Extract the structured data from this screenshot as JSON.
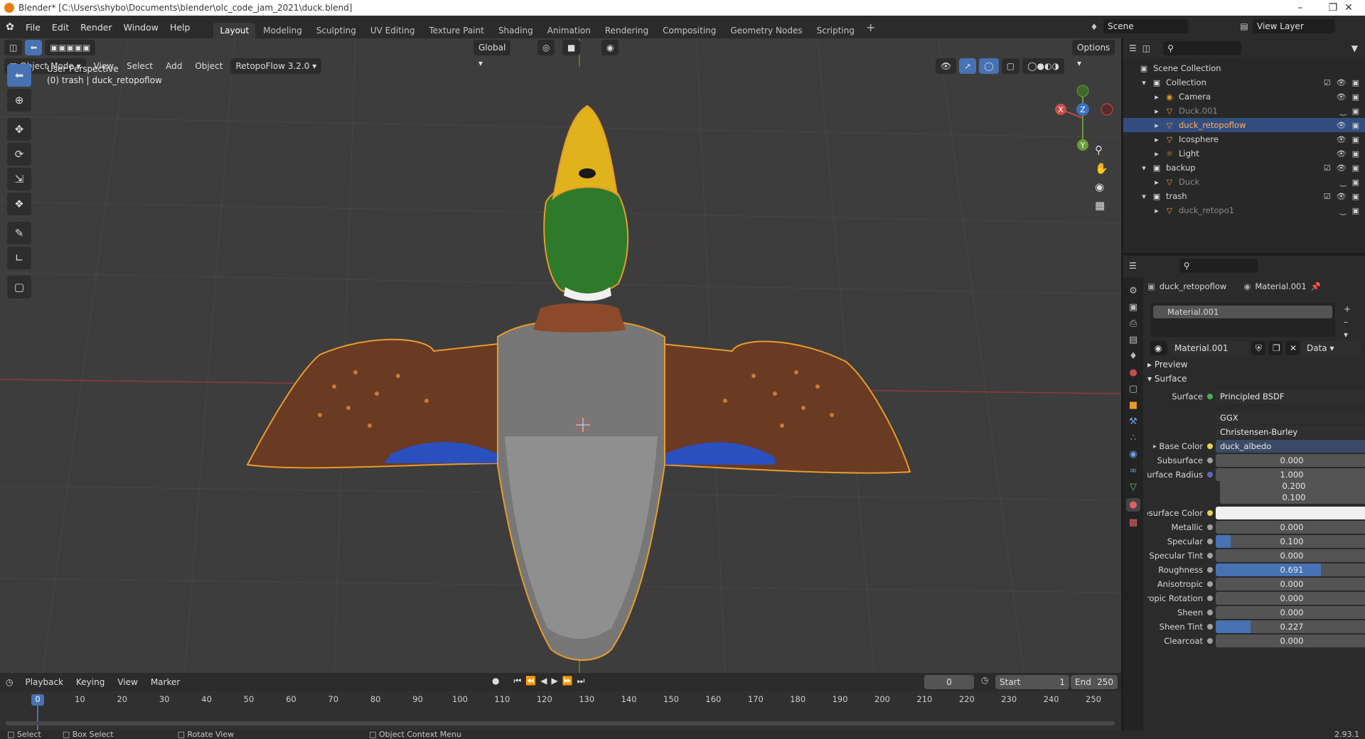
{
  "titlebar": {
    "title": "Blender* [C:\\Users\\shybo\\Documents\\blender\\olc_code_jam_2021\\duck.blend]"
  },
  "menu": [
    "File",
    "Edit",
    "Render",
    "Window",
    "Help"
  ],
  "workspaces": [
    "Layout",
    "Modeling",
    "Sculpting",
    "UV Editing",
    "Texture Paint",
    "Shading",
    "Animation",
    "Rendering",
    "Compositing",
    "Geometry Nodes",
    "Scripting"
  ],
  "active_workspace": "Layout",
  "scene": {
    "name": "Scene",
    "view_layer": "View Layer"
  },
  "viewport_header": {
    "mode": "Object Mode",
    "menus": [
      "View",
      "Select",
      "Add",
      "Object"
    ],
    "addon": "RetopoFlow 3.2.0",
    "orientation": "Global",
    "options": "Options"
  },
  "viewport": {
    "perspective": "User Perspective",
    "object_info": "(0) trash | duck_retopoflow",
    "gizmo": {
      "x": "X",
      "y": "Y",
      "z": "Z"
    }
  },
  "outliner": {
    "root": "Scene Collection",
    "rows": [
      {
        "label": "Collection",
        "type": "collection",
        "depth": 1
      },
      {
        "label": "Camera",
        "type": "camera",
        "depth": 2
      },
      {
        "label": "Duck.001",
        "type": "mesh",
        "depth": 2,
        "dim": true
      },
      {
        "label": "duck_retopoflow",
        "type": "mesh",
        "depth": 2,
        "selected": true
      },
      {
        "label": "Icosphere",
        "type": "mesh",
        "depth": 2
      },
      {
        "label": "Light",
        "type": "light",
        "depth": 2
      },
      {
        "label": "backup",
        "type": "collection",
        "depth": 1
      },
      {
        "label": "Duck",
        "type": "mesh",
        "depth": 2,
        "dim": true
      },
      {
        "label": "trash",
        "type": "collection",
        "depth": 1
      },
      {
        "label": "duck_retopo1",
        "type": "mesh",
        "depth": 2,
        "dim": true
      }
    ]
  },
  "properties": {
    "object": "duck_retopoflow",
    "material": "Material.001",
    "slot": "Material.001",
    "material_field": "Material.001",
    "link": "Data",
    "panels": {
      "preview": "Preview",
      "surface": "Surface"
    },
    "surface_shader": "Principled BSDF",
    "distribution": "GGX",
    "subsurface_method": "Christensen-Burley",
    "base_color": {
      "label": "Base Color",
      "value": "duck_albedo"
    },
    "rows": [
      {
        "label": "Subsurface",
        "value": "0.000",
        "fill": 0
      },
      {
        "label": "Subsurface Radius",
        "value": "1.000",
        "fill": 0
      },
      {
        "label": "",
        "value": "0.200",
        "fill": 0
      },
      {
        "label": "",
        "value": "0.100",
        "fill": 0
      },
      {
        "label": "Subsurface Color",
        "value": "",
        "fill": 0
      },
      {
        "label": "Metallic",
        "value": "0.000",
        "fill": 0
      },
      {
        "label": "Specular",
        "value": "0.100",
        "fill": 0.1
      },
      {
        "label": "Specular Tint",
        "value": "0.000",
        "fill": 0
      },
      {
        "label": "Roughness",
        "value": "0.691",
        "fill": 0.691
      },
      {
        "label": "Anisotropic",
        "value": "0.000",
        "fill": 0
      },
      {
        "label": "Anisotropic Rotation",
        "value": "0.000",
        "fill": 0
      },
      {
        "label": "Sheen",
        "value": "0.000",
        "fill": 0
      },
      {
        "label": "Sheen Tint",
        "value": "0.227",
        "fill": 0.227
      },
      {
        "label": "Clearcoat",
        "value": "0.000",
        "fill": 0
      }
    ]
  },
  "timeline": {
    "menus": [
      "Playback",
      "Keying",
      "View",
      "Marker"
    ],
    "current_frame": "0",
    "start_label": "Start",
    "start": "1",
    "end_label": "End",
    "end": "250",
    "ticks": [
      "0",
      "10",
      "20",
      "30",
      "40",
      "50",
      "60",
      "70",
      "80",
      "90",
      "100",
      "110",
      "120",
      "130",
      "140",
      "150",
      "160",
      "170",
      "180",
      "190",
      "200",
      "210",
      "220",
      "230",
      "240",
      "250"
    ]
  },
  "statusbar": {
    "select": "Select",
    "box_select": "Box Select",
    "rotate": "Rotate View",
    "context": "Object Context Menu",
    "version": "2.93.1"
  },
  "colors": {
    "accent": "#4772b3",
    "selection": "#e89b2c",
    "bg": "#3d3d3d"
  }
}
